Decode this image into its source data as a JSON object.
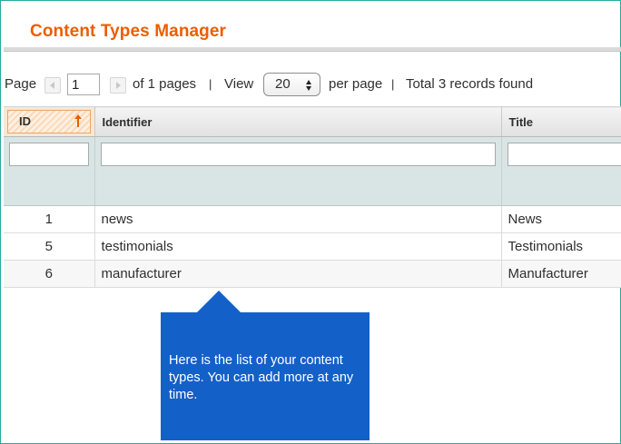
{
  "page": {
    "title": "Content Types Manager"
  },
  "pager": {
    "page_label": "Page",
    "current_page": "1",
    "of_pages": "of 1 pages",
    "separator": "|",
    "view_label": "View",
    "per_page_value": "20",
    "per_page_label": "per page",
    "total": "Total 3 records found"
  },
  "grid": {
    "columns": [
      {
        "key": "id",
        "label": "ID",
        "sorted": "asc"
      },
      {
        "key": "identifier",
        "label": "Identifier"
      },
      {
        "key": "title",
        "label": "Title"
      }
    ],
    "rows": [
      {
        "id": "1",
        "identifier": "news",
        "title": "News"
      },
      {
        "id": "5",
        "identifier": "testimonials",
        "title": "Testimonials"
      },
      {
        "id": "6",
        "identifier": "manufacturer",
        "title": "Manufacturer"
      }
    ]
  },
  "tooltip": {
    "text": "Here is the list of your content types. You can add more at any time."
  },
  "colors": {
    "title": "#eb5e00",
    "callout": "#1460c9",
    "filter_row": "#d9e5e5",
    "frame": "#2aa8a0"
  }
}
